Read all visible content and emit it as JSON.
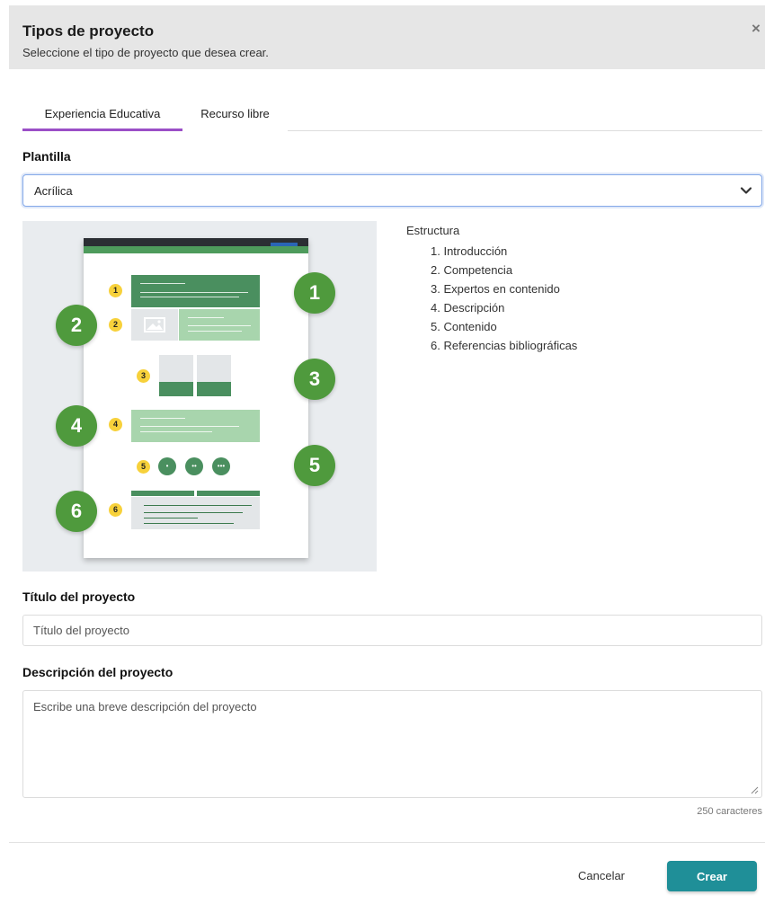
{
  "modal": {
    "title": "Tipos de proyecto",
    "subtitle": "Seleccione el tipo de proyecto que desea crear.",
    "close_icon": "×"
  },
  "tabs": [
    {
      "label": "Experiencia Educativa",
      "active": true
    },
    {
      "label": "Recurso libre",
      "active": false
    }
  ],
  "template": {
    "label": "Plantilla",
    "selected": "Acrílica"
  },
  "preview": {
    "small_badges": [
      "1",
      "2",
      "3",
      "4",
      "5",
      "6"
    ],
    "large_badges": [
      "1",
      "2",
      "3",
      "4",
      "5",
      "6"
    ],
    "circle_labels": [
      "•",
      "••",
      "•••"
    ],
    "accent_colors": {
      "dark_green": "#4a8f5f",
      "light_green": "#a8d5ad",
      "badge_green": "#4f9a3d",
      "badge_yellow": "#f7d13b"
    }
  },
  "structure": {
    "heading": "Estructura",
    "items": [
      "1. Introducción",
      "2. Competencia",
      "3. Expertos en contenido",
      "4. Descripción",
      "5. Contenido",
      "6. Referencias bibliográficas"
    ]
  },
  "project_title": {
    "label": "Título del proyecto",
    "placeholder": "Título del proyecto"
  },
  "project_description": {
    "label": "Descripción del proyecto",
    "placeholder": "Escribe una breve descripción del proyecto",
    "counter": "250 caracteres"
  },
  "footer": {
    "cancel_label": "Cancelar",
    "create_label": "Crear"
  },
  "colors": {
    "tab_accent": "#9b4fc7",
    "primary_button": "#1f8f98",
    "header_bg": "#e6e6e6"
  }
}
